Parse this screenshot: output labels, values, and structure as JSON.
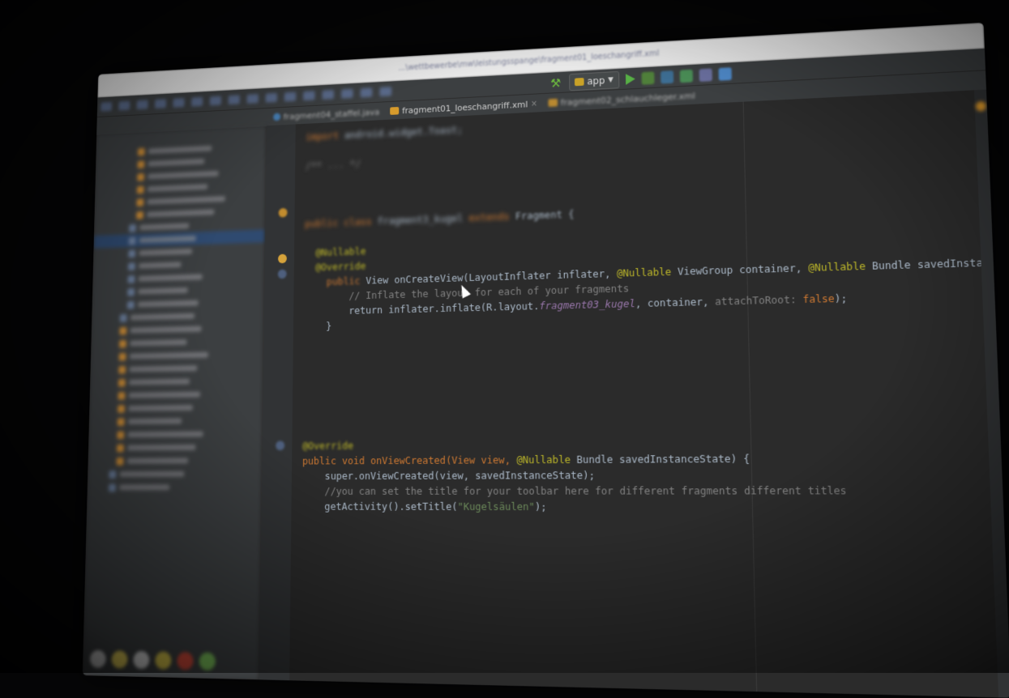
{
  "window": {
    "path_text": "...\\wettbewerbe\\mw\\leistungsspange\\fragment01_loeschangriff.xml"
  },
  "toolbar": {
    "run_config_label": "app",
    "icons": [
      "hammer-icon",
      "run-icon",
      "debug-icon",
      "sync-icon",
      "avd-icon",
      "sdk-icon",
      "search-icon"
    ]
  },
  "tabs": [
    {
      "label": "fragment04_staffel.java",
      "type": "java",
      "dimmed": true
    },
    {
      "label": "fragment01_loeschangriff.xml",
      "type": "xml",
      "dimmed": false
    },
    {
      "label": "fragment02_schlauchleger.xml",
      "type": "xml",
      "dimmed": true
    }
  ],
  "code": {
    "line1_fragment": "Fragment {",
    "line2_a": "View onCreateView(LayoutInflater inflater, ",
    "line2_ann": "@Nullable",
    "line2_b": " ViewGroup container, ",
    "line2_c": "@Nullable",
    "line2_d": " Bundle savedInstanceState) {",
    "line3": "// Inflate the layout for each of your fragments",
    "line4_a": "return inflater.inflate(R.layout.",
    "line4_b": "fragment03_kugel",
    "line4_c": ", container, ",
    "line4_d": "attachToRoot: ",
    "line4_e": "false",
    "line4_f": ");",
    "line5_ann": "@Override",
    "line6_a": "public void onViewCreated(View view, ",
    "line6_ann": "@Nullable",
    "line6_b": " Bundle savedInstanceState) {",
    "line7": "super.onViewCreated(view, savedInstanceState);",
    "line8": "//you can set the title for your toolbar here for different fragments different titles",
    "line9_a": "getActivity().setTitle(",
    "line9_str": "\"Kugelsäulen\"",
    "line9_b": ");"
  },
  "colors": {
    "keyword": "#cc7832",
    "annotation": "#bbb529",
    "field": "#9876aa",
    "string": "#6a8759",
    "comment": "#808080",
    "text": "#a9b7c6"
  }
}
